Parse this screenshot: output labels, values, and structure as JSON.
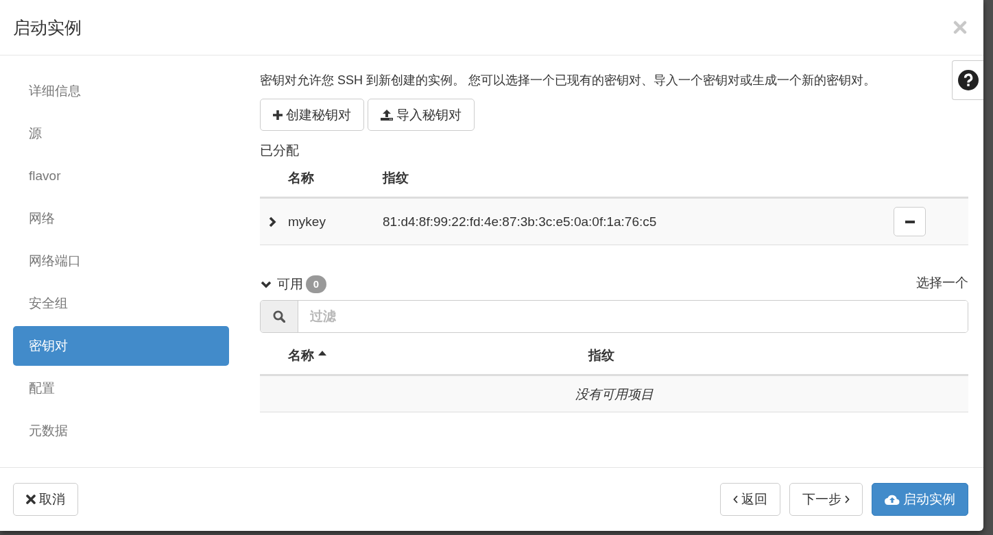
{
  "dialog": {
    "title": "启动实例"
  },
  "sidebar": {
    "items": [
      {
        "label": "详细信息",
        "selected": false
      },
      {
        "label": "源",
        "selected": false
      },
      {
        "label": "flavor",
        "selected": false
      },
      {
        "label": "网络",
        "selected": false
      },
      {
        "label": "网络端口",
        "selected": false
      },
      {
        "label": "安全组",
        "selected": false
      },
      {
        "label": "密钥对",
        "selected": true
      },
      {
        "label": "配置",
        "selected": false
      },
      {
        "label": "元数据",
        "selected": false
      }
    ]
  },
  "content": {
    "description": "密钥对允许您 SSH 到新创建的实例。 您可以选择一个已现有的密钥对、导入一个密钥对或生成一个新的密钥对。",
    "actions": [
      {
        "label": "创建秘钥对",
        "kind": "create"
      },
      {
        "label": "导入秘钥对",
        "kind": "import"
      }
    ],
    "allocated": {
      "title": "已分配",
      "columns": [
        {
          "label": "名称"
        },
        {
          "label": "指纹"
        }
      ],
      "rows": [
        {
          "name": "mykey",
          "fingerprint": "81:d4:8f:99:22:fd:4e:87:3b:3c:e5:0a:0f:1a:76:c5",
          "expanded": false
        }
      ]
    },
    "available": {
      "title": "可用",
      "count": "0",
      "expanded": true,
      "hint": "选择一个",
      "filter": {
        "placeholder": "过滤"
      },
      "columns": [
        {
          "label": "名称",
          "sorted": true
        },
        {
          "label": "指纹",
          "sorted": false
        }
      ],
      "empty_message": "没有可用项目"
    }
  },
  "footer": {
    "buttons": [
      {
        "label": "取消",
        "kind": "cancel"
      },
      {
        "label": "返回",
        "kind": "back"
      },
      {
        "label": "下一步",
        "kind": "next"
      },
      {
        "label": "启动实例",
        "kind": "launch"
      }
    ]
  }
}
